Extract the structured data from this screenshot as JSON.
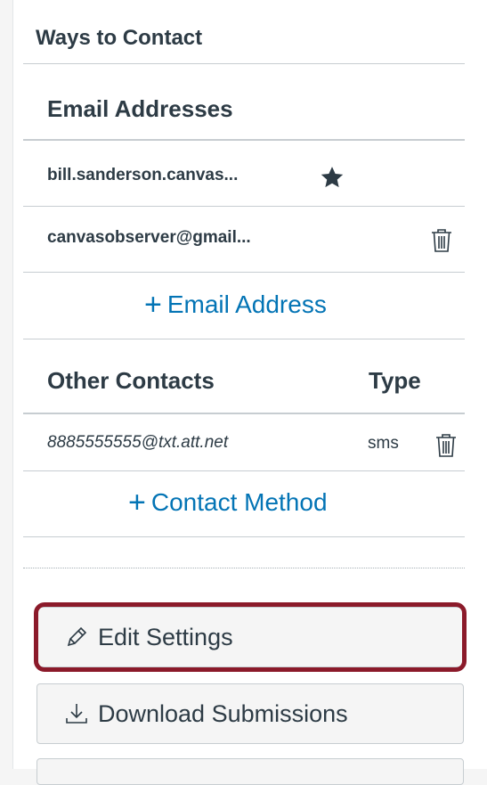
{
  "ways_to_contact": {
    "title": "Ways to Contact",
    "email_section": {
      "heading": "Email Addresses",
      "items": [
        {
          "address": "bill.sanderson.canvas...",
          "icon": "star-icon",
          "default": true
        },
        {
          "address": "canvasobserver@gmail...",
          "icon": "trash-icon",
          "default": false
        }
      ],
      "add_label": "Email Address"
    },
    "other_contacts": {
      "heading": "Other Contacts",
      "type_heading": "Type",
      "items": [
        {
          "address": "8885555555@txt.att.net",
          "type": "sms",
          "icon": "trash-icon"
        }
      ],
      "add_label": "Contact Method"
    }
  },
  "actions": {
    "edit_settings_label": "Edit Settings",
    "download_submissions_label": "Download Submissions"
  },
  "colors": {
    "link": "#0374b5",
    "text": "#2d3b45",
    "highlight": "#8b1a2a",
    "button_bg": "#f5f5f5"
  }
}
